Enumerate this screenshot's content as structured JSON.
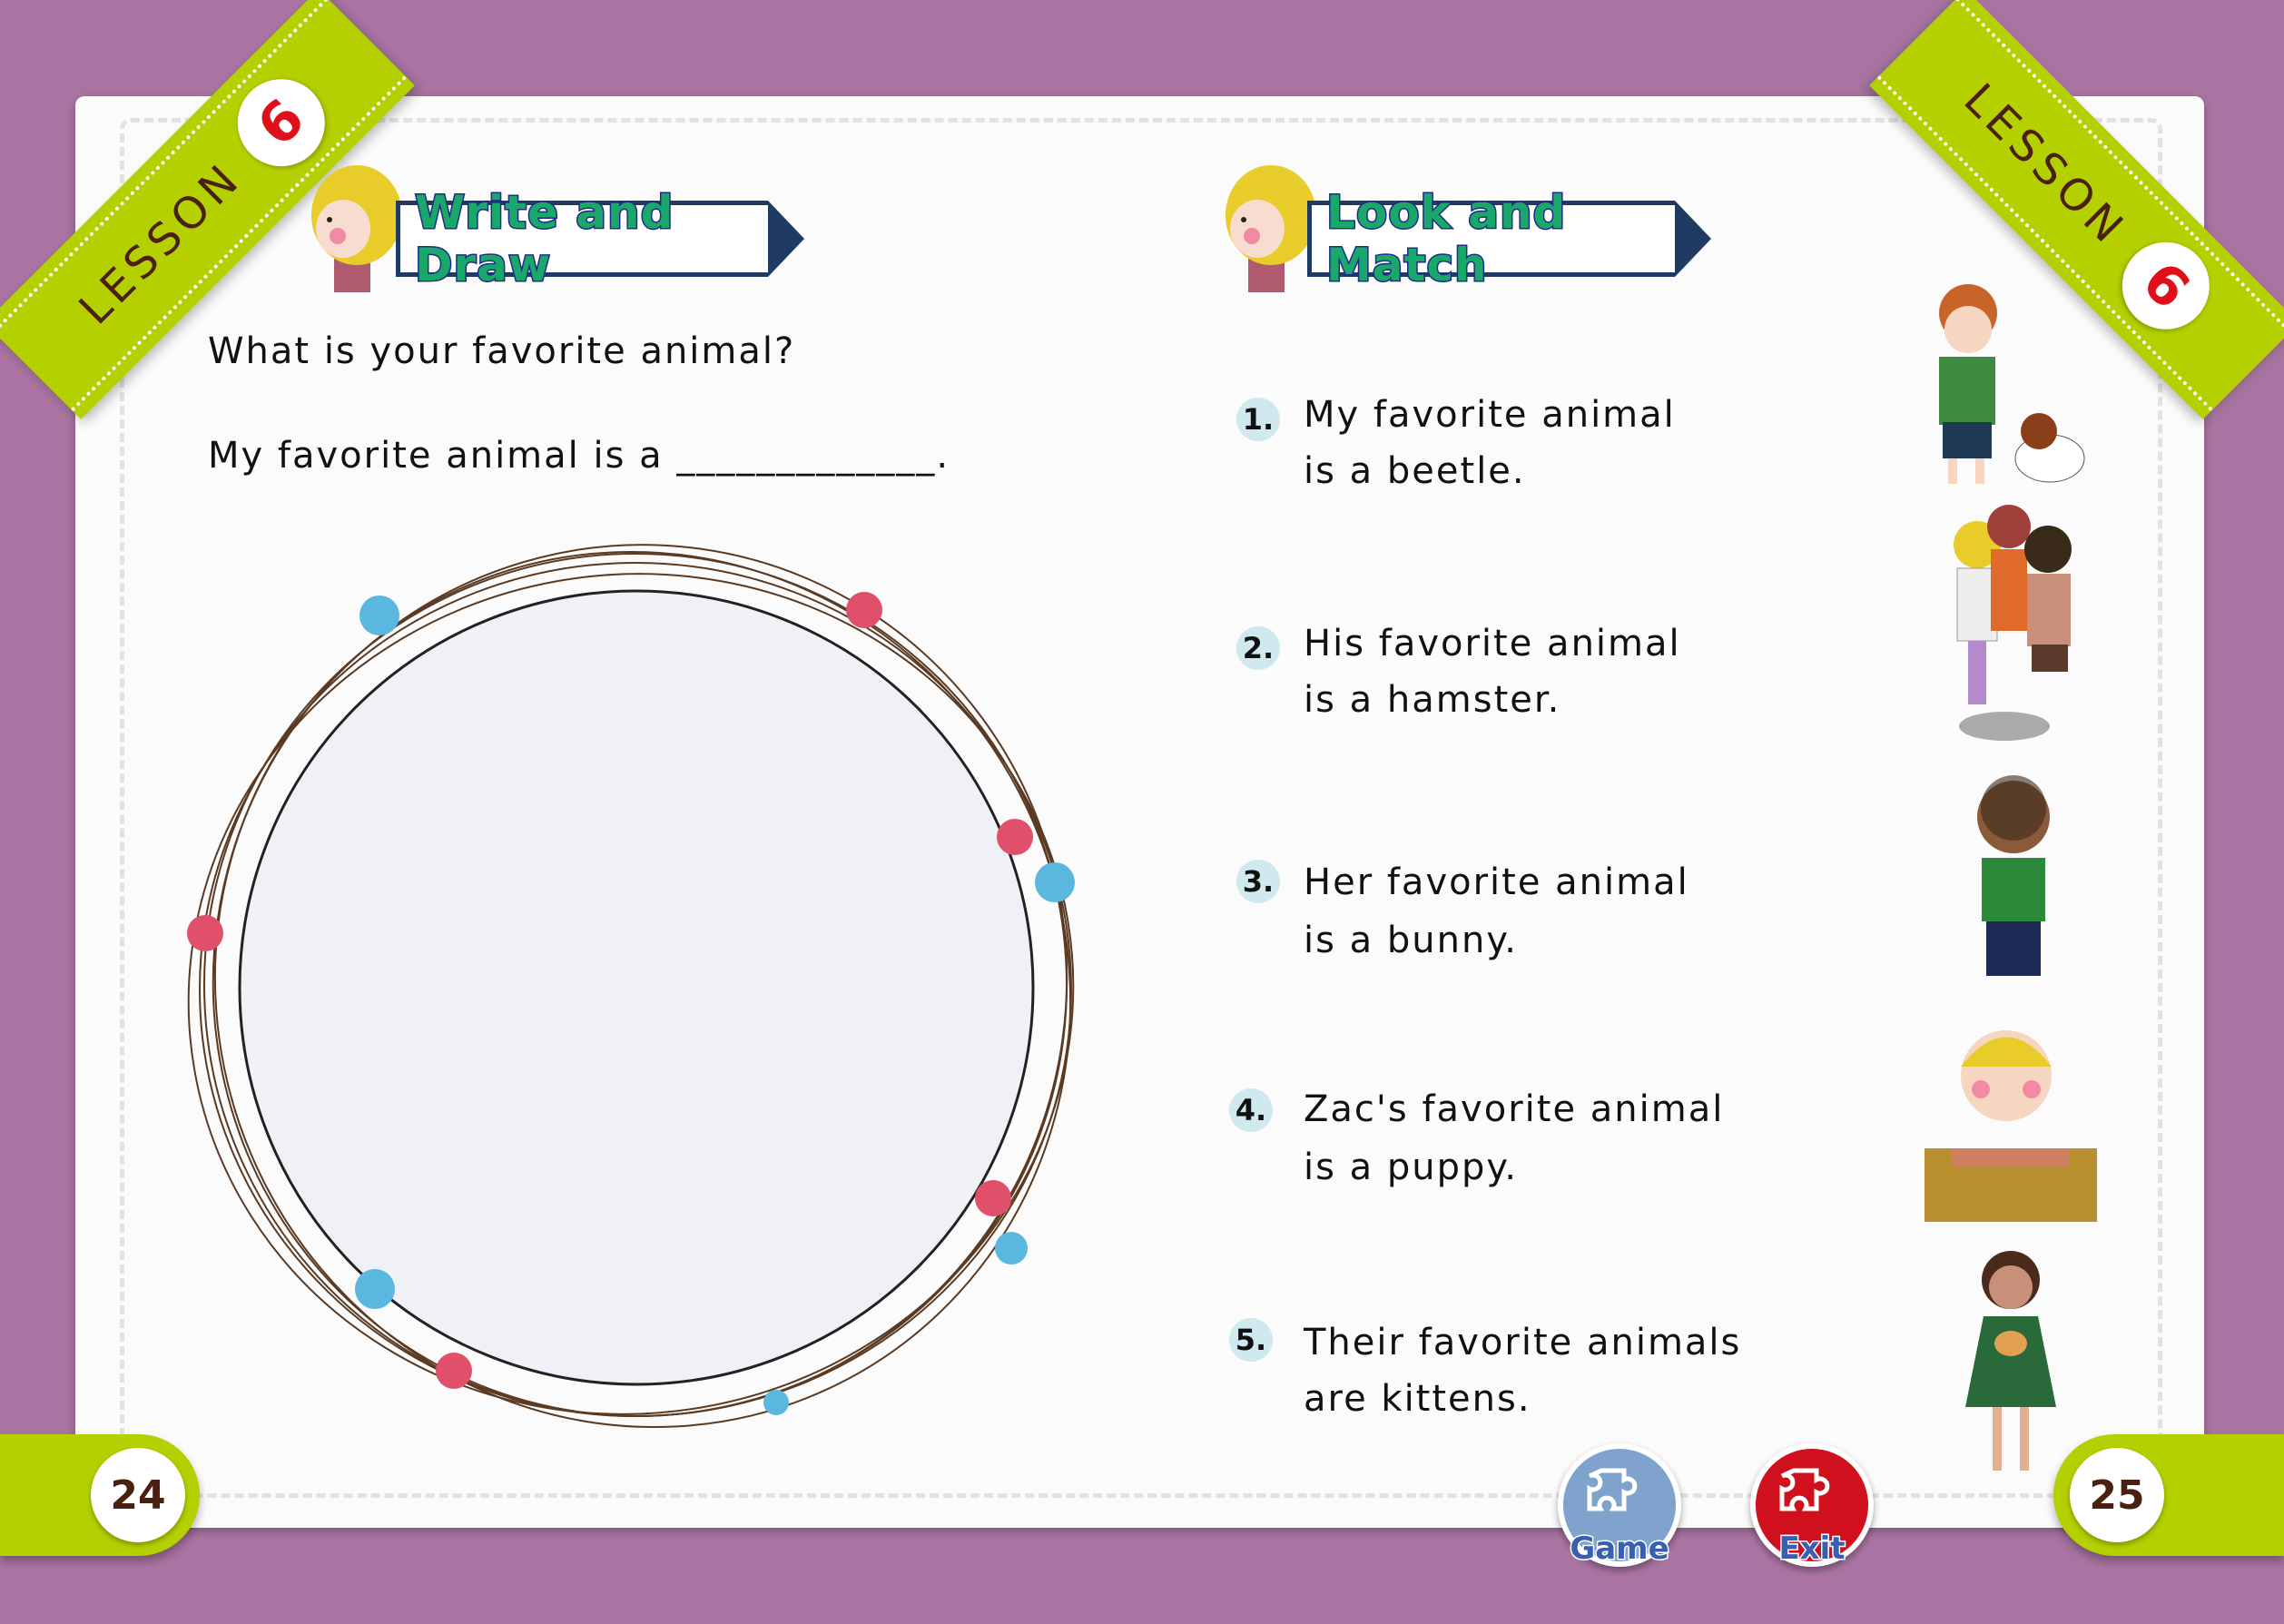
{
  "lesson": {
    "label": "LESSON",
    "number": "6"
  },
  "left_page": {
    "section_title": "Write and Draw",
    "question": "What is your favorite animal?",
    "answer_prompt": "My favorite animal is a _____________.",
    "page_number": "24"
  },
  "right_page": {
    "section_title": "Look and Match",
    "items": [
      {
        "number": "1.",
        "line1": "My favorite animal",
        "line2": "is a beetle."
      },
      {
        "number": "2.",
        "line1": "His favorite animal",
        "line2": "is a hamster."
      },
      {
        "number": "3.",
        "line1": "Her favorite animal",
        "line2": "is a bunny."
      },
      {
        "number": "4.",
        "line1": "Zac's favorite animal",
        "line2": "is a puppy."
      },
      {
        "number": "5.",
        "line1": "Their favorite animals",
        "line2": "are kittens."
      }
    ],
    "pictures": [
      "boy-with-puppy",
      "children-with-kittens",
      "boy-with-beetle",
      "boy-with-hamster",
      "girl-with-bunny"
    ],
    "page_number": "25"
  },
  "buttons": {
    "game": "Game",
    "exit": "Exit"
  },
  "colors": {
    "background": "#a974a1",
    "ribbon": "#b5d000",
    "title_green": "#1aa86a",
    "exit_red": "#d0101c",
    "game_blue": "#7fa3cc"
  }
}
